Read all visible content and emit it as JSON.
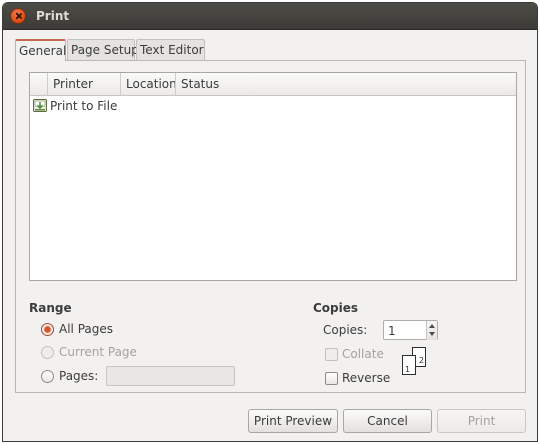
{
  "window": {
    "title": "Print"
  },
  "tabs": [
    {
      "label": "General",
      "active": true
    },
    {
      "label": "Page Setup",
      "active": false
    },
    {
      "label": "Text Editor",
      "active": false
    }
  ],
  "printer_list": {
    "columns": [
      "Printer",
      "Location",
      "Status"
    ],
    "rows": [
      {
        "icon": "print-to-file-icon",
        "name": "Print to File",
        "location": "",
        "status": ""
      }
    ]
  },
  "range": {
    "title": "Range",
    "options": [
      {
        "label": "All Pages",
        "selected": true,
        "enabled": true
      },
      {
        "label": "Current Page",
        "selected": false,
        "enabled": false
      },
      {
        "label": "Pages:",
        "selected": false,
        "enabled": true
      }
    ],
    "pages_value": ""
  },
  "copies": {
    "title": "Copies",
    "copies_label": "Copies:",
    "copies_value": "1",
    "collate_label": "Collate",
    "collate_checked": false,
    "collate_enabled": false,
    "reverse_label": "Reverse",
    "reverse_checked": false,
    "collate_pages": [
      "1",
      "2"
    ]
  },
  "buttons": {
    "print_preview": "Print Preview",
    "cancel": "Cancel",
    "print": "Print"
  },
  "colors": {
    "accent": "#d9542b",
    "titlebar": "#3c3b37"
  }
}
